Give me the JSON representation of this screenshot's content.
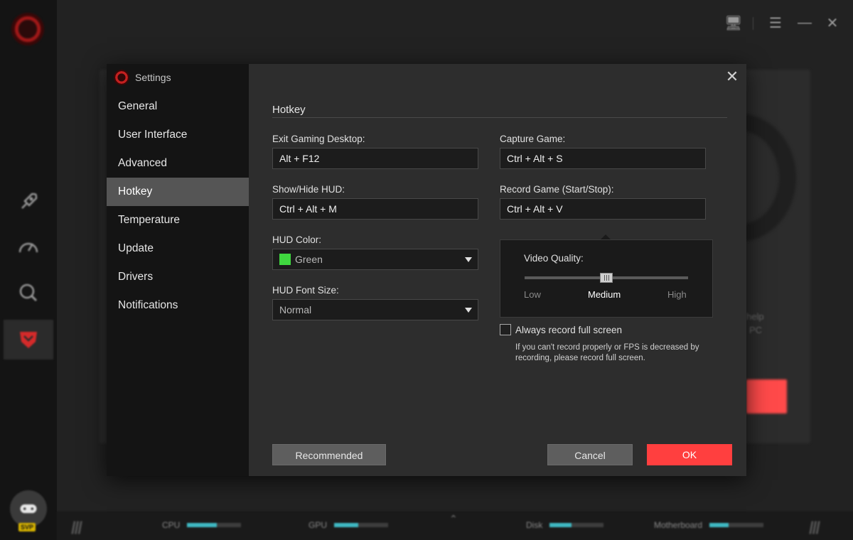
{
  "background": {
    "side_text_1": "help",
    "side_text_2": "PC",
    "badge": "SVP",
    "status": [
      {
        "label": "CPU",
        "level": 0.55
      },
      {
        "label": "GPU",
        "level": 0.45
      },
      {
        "label": "Disk",
        "level": 0.4
      },
      {
        "label": "Motherboard",
        "level": 0.35
      }
    ]
  },
  "dialog": {
    "title": "Settings",
    "nav": [
      {
        "label": "General"
      },
      {
        "label": "User Interface"
      },
      {
        "label": "Advanced"
      },
      {
        "label": "Hotkey"
      },
      {
        "label": "Temperature"
      },
      {
        "label": "Update"
      },
      {
        "label": "Drivers"
      },
      {
        "label": "Notifications"
      }
    ],
    "active_nav": "Hotkey",
    "section_title": "Hotkey",
    "fields": {
      "exit_gaming_desktop": {
        "label": "Exit Gaming Desktop:",
        "value": "Alt + F12"
      },
      "capture_game": {
        "label": "Capture Game:",
        "value": "Ctrl + Alt + S"
      },
      "show_hide_hud": {
        "label": "Show/Hide HUD:",
        "value": "Ctrl + Alt + M"
      },
      "record_game": {
        "label": "Record Game (Start/Stop):",
        "value": "Ctrl + Alt + V"
      },
      "hud_color": {
        "label": "HUD Color:",
        "value": "Green",
        "swatch": "#3fd83f"
      },
      "hud_font_size": {
        "label": "HUD Font Size:",
        "value": "Normal"
      }
    },
    "video_quality": {
      "label": "Video Quality:",
      "ticks": [
        "Low",
        "Medium",
        "High"
      ],
      "selected": "Medium",
      "level": 0.5
    },
    "always_record_full_screen": {
      "label": "Always record full screen",
      "checked": false,
      "hint": "If you can't record properly or FPS is decreased by recording, please record full screen."
    },
    "buttons": {
      "recommended": "Recommended",
      "cancel": "Cancel",
      "ok": "OK"
    },
    "colors": {
      "accent": "#ff3f3f",
      "nav_active": "#555555"
    }
  }
}
